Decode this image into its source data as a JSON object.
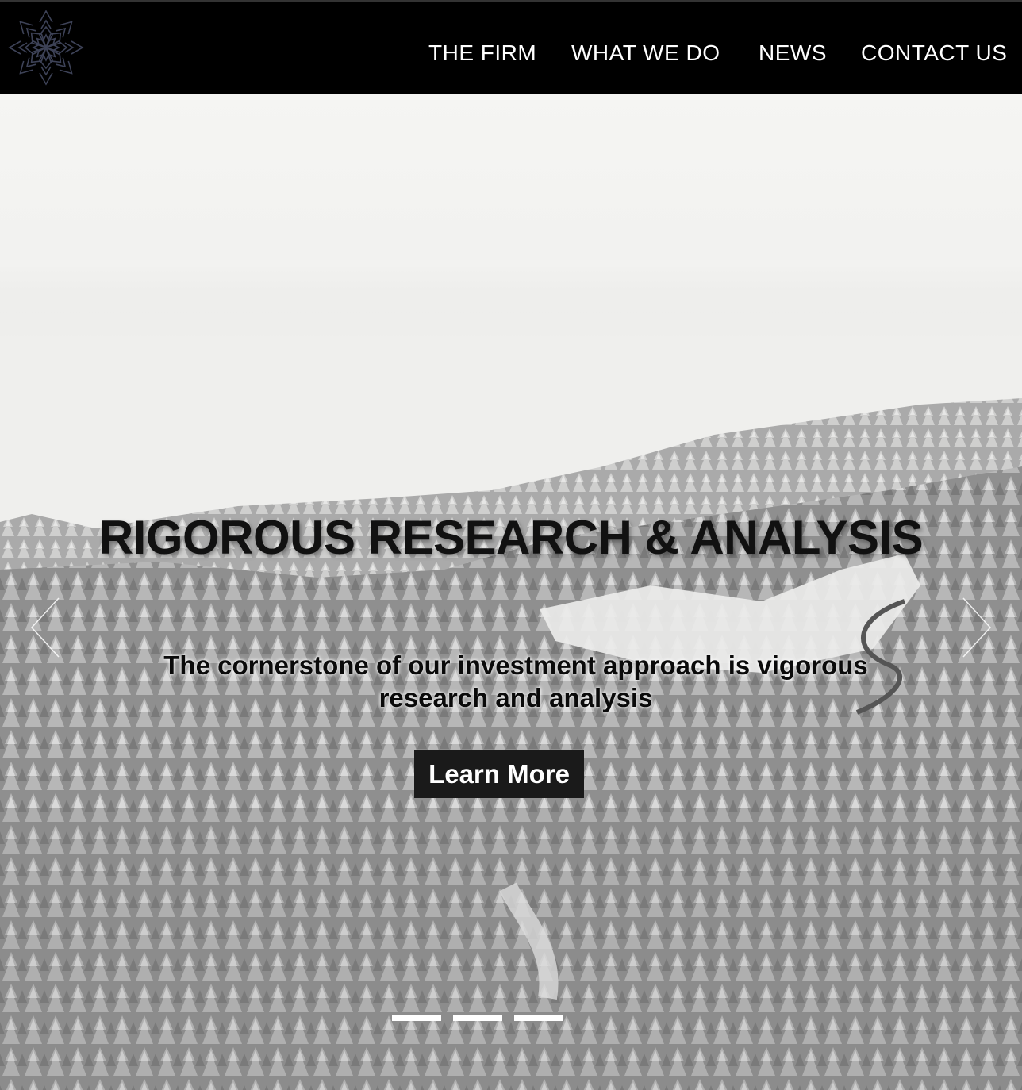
{
  "header": {
    "logo_icon": "snowflake-logo-icon",
    "nav": [
      {
        "label": "THE FIRM"
      },
      {
        "label": "WHAT WE DO"
      },
      {
        "label": "NEWS"
      },
      {
        "label": "CONTACT US"
      }
    ]
  },
  "hero": {
    "title": "RIGOROUS RESEARCH & ANALYSIS",
    "subtitle": "The cornerstone of our investment approach is vigorous research and analysis",
    "cta_label": "Learn More",
    "prev_icon": "chevron-left-icon",
    "next_icon": "chevron-right-icon",
    "slide_count": 3
  },
  "colors": {
    "nav_background": "#000000",
    "nav_text": "#ffffff",
    "button_background": "#1a1a1a",
    "logo_stroke": "#3d4257"
  }
}
